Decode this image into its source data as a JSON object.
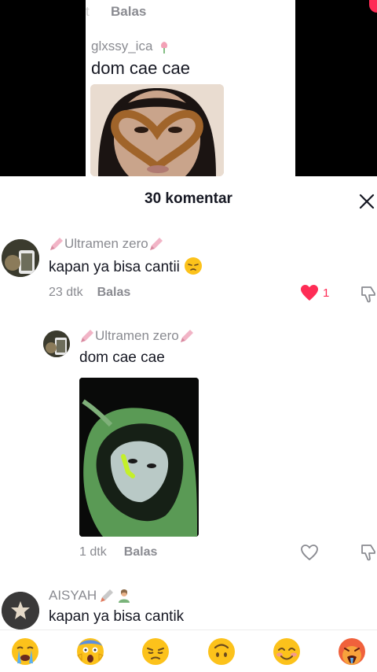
{
  "video": {
    "top_faded": "t",
    "top_reply": "Balas",
    "username": "glxssy_ica",
    "text": "dom cae cae"
  },
  "sheet": {
    "title": "30 komentar"
  },
  "comments": [
    {
      "username": "Ultramen zero",
      "text": "kapan ya bisa cantii",
      "time": "23 dtk",
      "reply_label": "Balas",
      "likes": "1",
      "liked": true
    },
    {
      "username": "Ultramen zero",
      "text": "dom cae cae",
      "time": "1 dtk",
      "reply_label": "Balas",
      "liked": false
    },
    {
      "username": "AISYAH",
      "text": "kapan ya bisa cantik"
    }
  ],
  "emoji_bar": {
    "items": [
      "crying-face",
      "screaming-face",
      "pensive-face",
      "upside-down-face",
      "smiling-face",
      "hot-face"
    ]
  },
  "colors": {
    "accent": "#fe2c55",
    "muted": "#8a8b91",
    "text": "#161823"
  }
}
